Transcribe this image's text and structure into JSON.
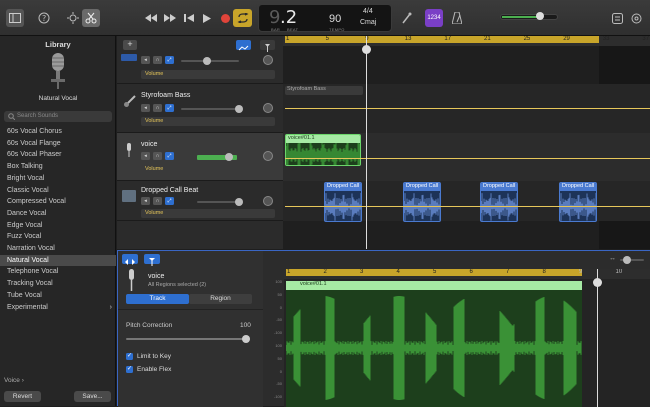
{
  "toolbar": {
    "lcd": {
      "bar": "9",
      "beat": ".2",
      "bar_label": "BAR",
      "beat_label": "BEAT",
      "tempo": "90",
      "tempo_label": "TEMPO",
      "signature": "4/4",
      "key": "Cmaj"
    },
    "count_in": "1234",
    "icons": [
      "library-icon",
      "help-icon",
      "smart-controls-icon",
      "scissors-icon",
      "rewind-icon",
      "forward-icon",
      "go-to-start-icon",
      "play-icon",
      "record-icon",
      "cycle-icon",
      "tuner-icon",
      "count-in-icon",
      "metronome-icon",
      "master-volume-icon",
      "notepad-icon",
      "loop-browser-icon"
    ],
    "master_volume": 0.7
  },
  "library": {
    "title": "Library",
    "patch_name": "Natural Vocal",
    "search_placeholder": "Search Sounds",
    "items": [
      "60s Vocal Chorus",
      "60s Vocal Flange",
      "60s Vocal Phaser",
      "Box Talking",
      "Bright Vocal",
      "Classic Vocal",
      "Compressed Vocal",
      "Dance Vocal",
      "Edge Vocal",
      "Fuzz Vocal",
      "Narration Vocal",
      "Natural Vocal",
      "Telephone Vocal",
      "Tracking Vocal",
      "Tube Vocal",
      "Experimental"
    ],
    "selected": "Natural Vocal",
    "breadcrumb": "Voice",
    "revert_label": "Revert",
    "save_label": "Save..."
  },
  "tracks": [
    {
      "name": "",
      "automation": "Volume"
    },
    {
      "name": "Styrofoam Bass",
      "automation": "Volume"
    },
    {
      "name": "voice",
      "automation": "Volume"
    },
    {
      "name": "Dropped Call Beat",
      "automation": "Volume"
    }
  ],
  "ruler": {
    "bars": [
      "1",
      "5",
      "9",
      "13",
      "17",
      "21",
      "25",
      "29",
      "33",
      "37"
    ]
  },
  "regions": {
    "bass": "Styrofoam Bass",
    "voice": "voice#01.1",
    "beats": [
      "Dropped Call",
      "Dropped Call",
      "Dropped Call",
      "Dropped Call"
    ]
  },
  "editor": {
    "track_name": "voice",
    "subtitle": "All Regions selected (2)",
    "tab_track": "Track",
    "tab_region": "Region",
    "pitch_label": "Pitch Correction",
    "pitch_value": "100",
    "limit_label": "Limit to Key",
    "flex_label": "Enable Flex",
    "ruler": [
      "1",
      "2",
      "3",
      "4",
      "5",
      "6",
      "7",
      "8",
      "9",
      "10"
    ],
    "region_label": "voice#01.1",
    "scale": [
      "100",
      "50",
      "0",
      "-50",
      "-100",
      "100",
      "50",
      "0",
      "-50",
      "-100"
    ]
  },
  "colors": {
    "accent": "#2e6fd0",
    "cycle": "#c8a52a",
    "audio_green": "#3e9b3a",
    "region_blue": "#2d5aa8",
    "record": "#e0443a"
  }
}
